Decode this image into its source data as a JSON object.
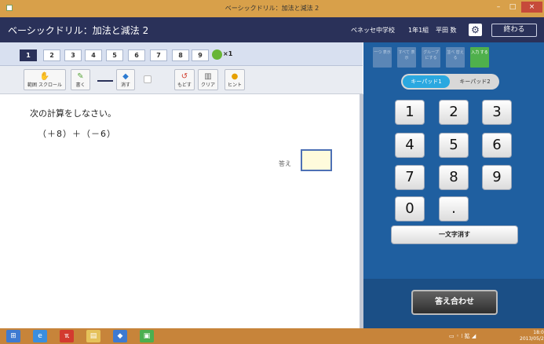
{
  "window": {
    "title": "ベーシックドリル：加法と減法 2",
    "minimize": "–",
    "maximize": "□",
    "close": "×"
  },
  "header": {
    "app_title": "ベーシックドリル：加法と減法 2",
    "school": "ベネッセ中学校",
    "class": "1年1組",
    "student": "平田 数",
    "settings_icon": "gear-icon",
    "finish_label": "終わる"
  },
  "pages": {
    "items": [
      "1",
      "2",
      "3",
      "4",
      "5",
      "6",
      "7",
      "8",
      "9"
    ],
    "active": "1",
    "correct_count": "×1"
  },
  "toolbar": {
    "scroll_label": "範囲 スクロール",
    "write_label": "書く",
    "erase_label": "消す",
    "undo_label": "もどす",
    "clear_label": "クリア",
    "hint_label": "ヒント"
  },
  "question": {
    "instruction": "次の計算をしなさい。",
    "problem": "（＋8）＋（－6）",
    "answer_label": "答え",
    "answer_value": ""
  },
  "panel": {
    "tabs": [
      {
        "label": "一つ 表示",
        "active": false
      },
      {
        "label": "すべて 表示",
        "active": false
      },
      {
        "label": "グループ にする",
        "active": false
      },
      {
        "label": "並べ 替える",
        "active": false
      },
      {
        "label": "入力 する",
        "active": true
      }
    ],
    "keypad1_label": "キーパッド1",
    "keypad2_label": "キーパッド2",
    "keys": [
      "1",
      "2",
      "3",
      "4",
      "5",
      "6",
      "7",
      "8",
      "9",
      "0",
      "."
    ],
    "delete_label": "一文字消す",
    "check_label": "答え合わせ"
  },
  "taskbar": {
    "tray_text": "▭ ◦ ⁞ 拡 ◢",
    "clock_time": "18:03",
    "clock_date": "2013/05/21"
  },
  "colors": {
    "titlebar": "#d8a04a",
    "header": "#2a3159",
    "panel": "#1f5fa0",
    "active_tab": "#4fb04c",
    "keypad_active": "#2aa8e0"
  }
}
